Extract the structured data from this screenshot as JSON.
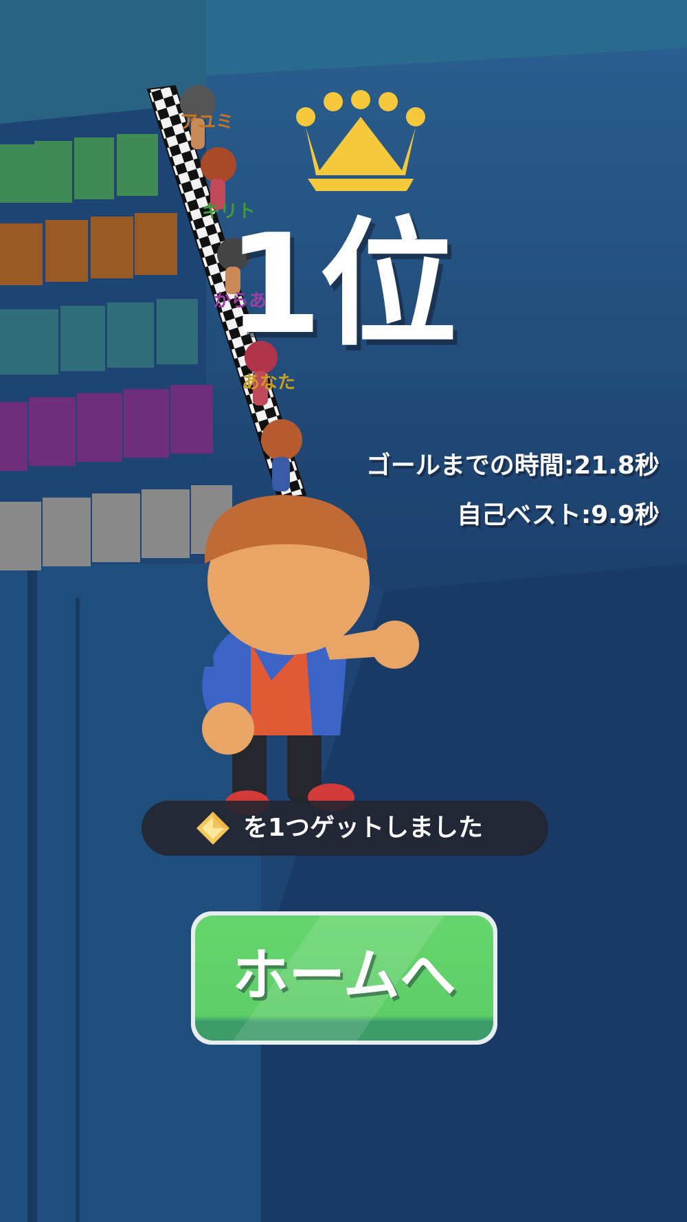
{
  "result": {
    "rank_label": "1位",
    "goal_time": "ゴールまでの時間:21.8秒",
    "best_time": "自己ベスト:9.9秒"
  },
  "reward": {
    "icon": "diamond-gem-icon",
    "text": "を1つゲットしました"
  },
  "home_button": {
    "label": "ホームへ"
  },
  "racers": [
    {
      "name": "アユミ",
      "color": "#c9741f"
    },
    {
      "name": "キリト",
      "color": "#3f9a3a"
    },
    {
      "name": "からあ",
      "color": "#9c3fa7"
    },
    {
      "name": "あなた",
      "color": "#c9a01f"
    }
  ],
  "colors": {
    "crown": "#f6c93c",
    "button_green": "#5fd06a",
    "banner_bg": "#23262f",
    "text_white": "#ffffff",
    "background_blue": "#1f4d7e"
  }
}
